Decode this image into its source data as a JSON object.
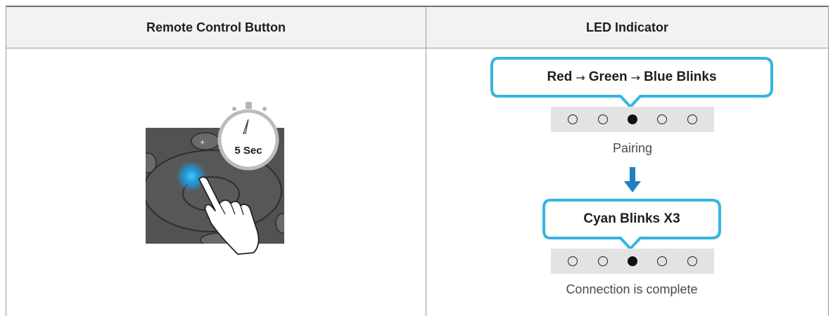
{
  "table": {
    "headers": [
      "Remote Control Button",
      "LED Indicator"
    ]
  },
  "illustration": {
    "timer_label": "5 Sec"
  },
  "pairing": {
    "callout_parts": [
      "Red",
      "Green",
      "Blue Blinks"
    ],
    "arrow_glyph": "→",
    "leds": [
      false,
      false,
      true,
      false,
      false
    ],
    "status": "Pairing"
  },
  "complete": {
    "callout": "Cyan Blinks X3",
    "leds": [
      false,
      false,
      true,
      false,
      false
    ],
    "status": "Connection is complete"
  },
  "colors": {
    "callout_border": "#35b5e0",
    "arrow": "#1e7fc2",
    "press_glow": "#1aa0e8"
  }
}
